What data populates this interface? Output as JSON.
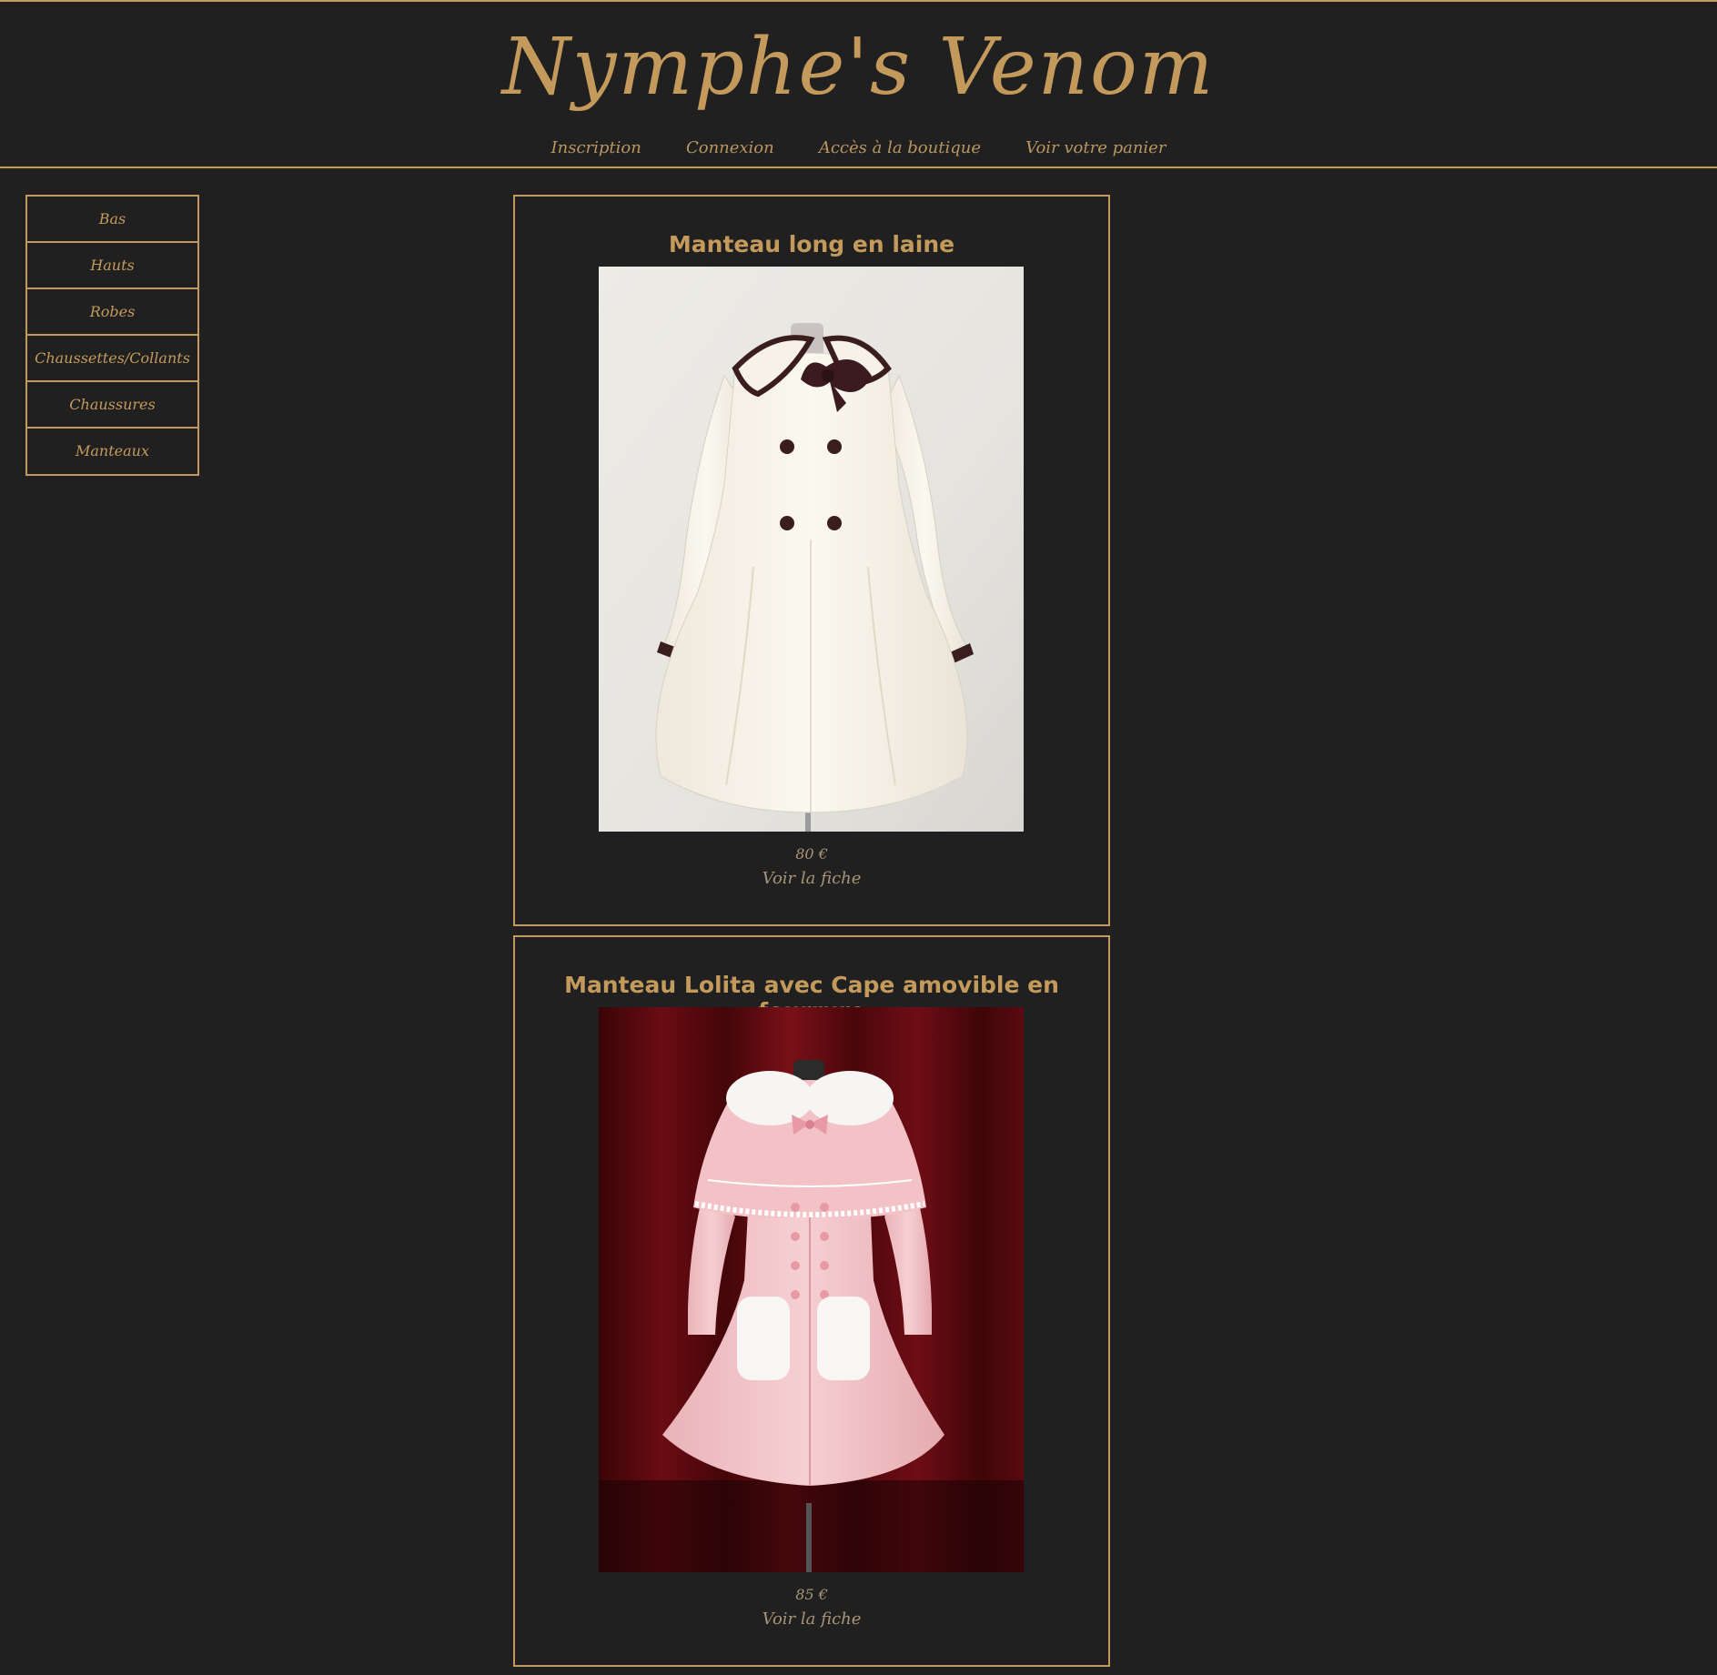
{
  "site": {
    "title": "Nymphe's Venom"
  },
  "nav": [
    {
      "label": "Inscription"
    },
    {
      "label": "Connexion"
    },
    {
      "label": "Accès à la boutique"
    },
    {
      "label": "Voir votre panier"
    }
  ],
  "sidebar": {
    "items": [
      {
        "label": "Bas"
      },
      {
        "label": "Hauts"
      },
      {
        "label": "Robes"
      },
      {
        "label": "Chaussettes/Collants"
      },
      {
        "label": "Chaussures"
      },
      {
        "label": "Manteaux"
      }
    ]
  },
  "products": [
    {
      "title": "Manteau long en laine",
      "price": "80 €",
      "link_label": "Voir la fiche"
    },
    {
      "title": "Manteau Lolita avec Cape amovible en fourrure",
      "price": "85 €",
      "link_label": "Voir la fiche"
    }
  ],
  "colors": {
    "background": "#202020",
    "accent": "#c49a5c",
    "muted": "#a89478"
  }
}
